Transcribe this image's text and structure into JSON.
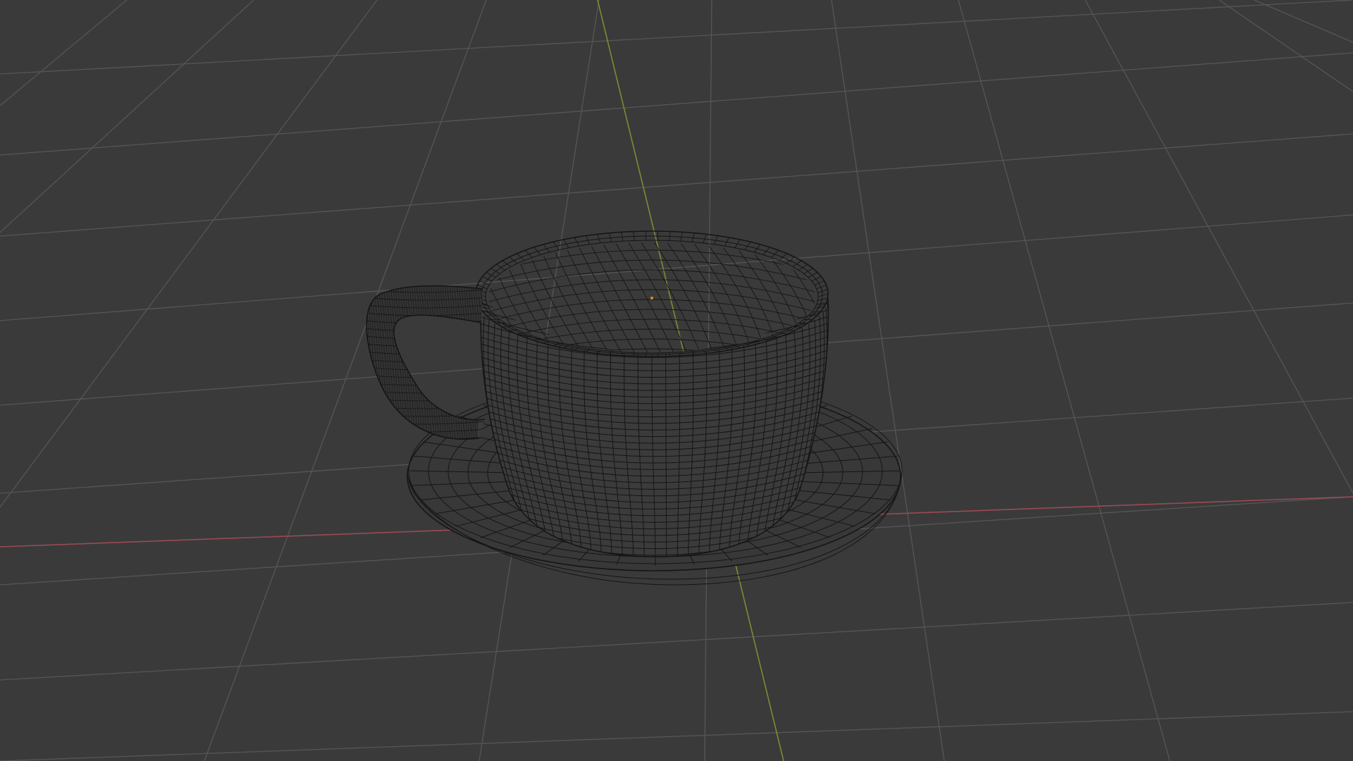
{
  "viewport": {
    "mode": "wireframe",
    "background_color": "#3a3a3a",
    "grid_color": "#565656",
    "x_axis_color": "#9a4a55",
    "y_axis_color": "#7f8a34",
    "wire_color": "#151515",
    "origin_color": "#e08a1e"
  },
  "scene": {
    "object": "teacup-with-saucer"
  }
}
